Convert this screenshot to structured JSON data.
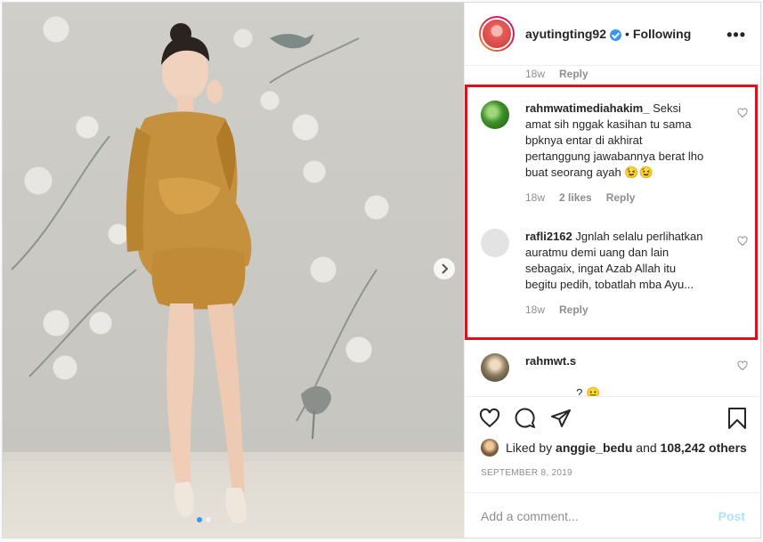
{
  "header": {
    "username": "ayutingting92",
    "bullet": "•",
    "follow_status": "Following",
    "more_label": "•••"
  },
  "comments": {
    "top_meta": {
      "time": "18w",
      "reply": "Reply"
    },
    "items": [
      {
        "username": "rahmwatimediahakim_",
        "text": "Seksi amat sih nggak kasihan tu sama bpknya entar di akhirat pertanggung jawabannya berat lho buat seorang ayah 😉😉",
        "time": "18w",
        "likes": "2 likes",
        "reply": "Reply"
      },
      {
        "username": "rafli2162",
        "text": "Jgnlah selalu perlihatkan auratmu demi uang dan lain sebagaix, ingat Azab Allah itu begitu pedih, tobatlah mba Ayu...",
        "time": "18w",
        "reply": "Reply"
      },
      {
        "username": "rahmwt.s",
        "text": "⠀⠀⠀⠀⠀ ⠀⠀⠀⠀⠀⠀ ⠀⠀⠀⠀⠀⠀⠀ ⠀⠀⠀⠀ ⠀⠀ ⠀⠀⠀⠀⠀⠀ ⠀⠀⠀⠀⠀⠀? 😐 ⠀⠀⠀⠀⠀⠀⠀"
      }
    ],
    "highlight_color": "#e0101b"
  },
  "actions": {
    "liked_by_prefix": "Liked by ",
    "liked_by_user": "anggie_bedu",
    "liked_and": " and ",
    "liked_others": "108,242 others",
    "date": "SEPTEMBER 8, 2019",
    "comment_placeholder": "Add a comment...",
    "post_label": "Post"
  },
  "icons": [
    "heart-icon",
    "comment-icon",
    "share-icon",
    "bookmark-icon",
    "chevron-right-icon",
    "verified-icon"
  ],
  "carousel": {
    "current": 1,
    "total": 2
  },
  "colors": {
    "accent": "#3897f0",
    "post_button": "#b2dffc",
    "muted": "#8e8e8e"
  }
}
